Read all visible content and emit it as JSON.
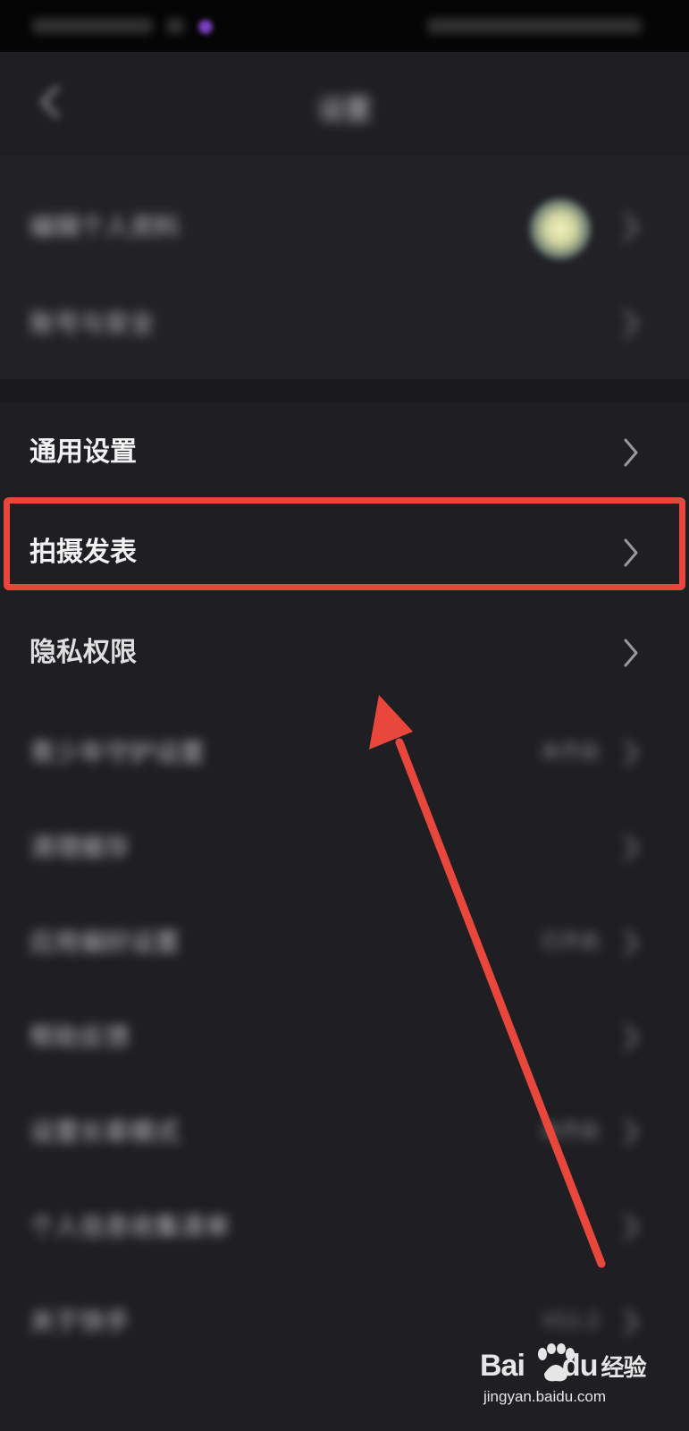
{
  "nav": {
    "title": "设置"
  },
  "account_rows": [
    {
      "label": "编辑个人资料"
    },
    {
      "label": "账号与安全"
    }
  ],
  "menu": {
    "general_settings": "通用设置",
    "shoot_publish": "拍摄发表",
    "privacy_permissions": "隐私权限"
  },
  "blurred_rows": [
    {
      "label": "青少年守护设置",
      "value": "未开启"
    },
    {
      "label": "清理缓存",
      "value": ""
    },
    {
      "label": "应用偏好设置",
      "value": "已开启"
    },
    {
      "label": "帮助反馈",
      "value": ""
    },
    {
      "label": "设置长辈模式",
      "value": "未开启"
    },
    {
      "label": "个人信息收集清单",
      "value": ""
    },
    {
      "label": "关于快手",
      "value": "V11.2"
    }
  ],
  "watermark": {
    "logo_left": "Bai",
    "logo_right": "du",
    "logo_suffix": "经验",
    "url": "jingyan.baidu.com"
  },
  "colors": {
    "background": "#1f1e23",
    "highlight": "#e9473c",
    "text": "#f2f2f2"
  }
}
